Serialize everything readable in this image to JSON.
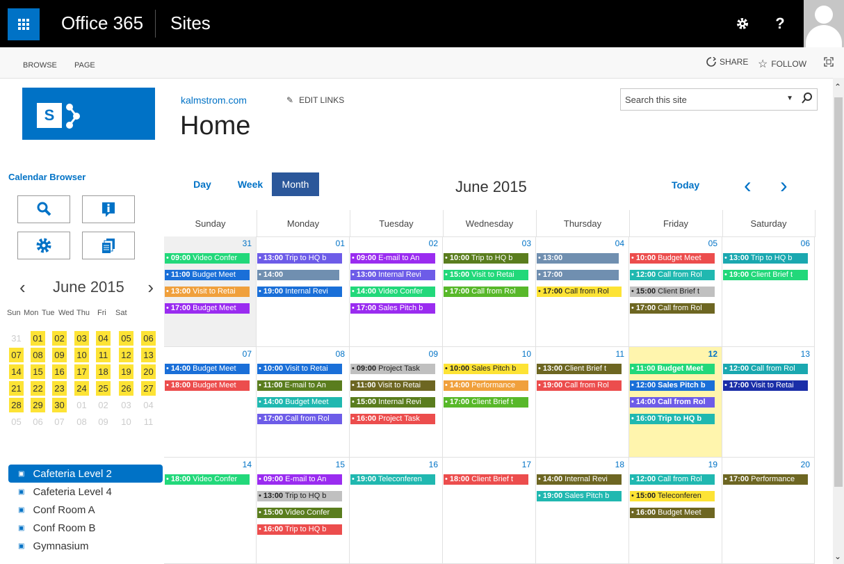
{
  "suite": {
    "app_name": "Office 365",
    "section": "Sites"
  },
  "ribbon": {
    "tabs": [
      "BROWSE",
      "PAGE"
    ],
    "share": "SHARE",
    "follow": "FOLLOW"
  },
  "header": {
    "site_link": "kalmstrom.com",
    "edit_links": "EDIT LINKS",
    "title": "Home"
  },
  "search": {
    "placeholder": "Search this site"
  },
  "calendar_browser": {
    "title": "Calendar Browser",
    "mini": {
      "title": "June 2015",
      "weekdays": [
        "Sun",
        "Mon",
        "Tue",
        "Wed",
        "Thu",
        "Fri",
        "Sat"
      ],
      "weeks": [
        [
          "31",
          "01",
          "02",
          "03",
          "04",
          "05",
          "06"
        ],
        [
          "07",
          "08",
          "09",
          "10",
          "11",
          "12",
          "13"
        ],
        [
          "14",
          "15",
          "16",
          "17",
          "18",
          "19",
          "20"
        ],
        [
          "21",
          "22",
          "23",
          "24",
          "25",
          "26",
          "27"
        ],
        [
          "28",
          "29",
          "30",
          "01",
          "02",
          "03",
          "04"
        ],
        [
          "05",
          "06",
          "07",
          "08",
          "09",
          "10",
          "11"
        ]
      ]
    }
  },
  "resources": [
    "Cafeteria Level 2",
    "Cafeteria Level 4",
    "Conf Room A",
    "Conf Room B",
    "Gymnasium"
  ],
  "calendar": {
    "views": [
      "Day",
      "Week",
      "Month"
    ],
    "active_view": "Month",
    "month_title": "June 2015",
    "today_label": "Today",
    "days": [
      "Sunday",
      "Monday",
      "Tuesday",
      "Wednesday",
      "Thursday",
      "Friday",
      "Saturday"
    ],
    "weeks": [
      {
        "dates": [
          "31",
          "01",
          "02",
          "03",
          "04",
          "05",
          "06"
        ],
        "events": [
          [
            [
              "09:00",
              "Video Confer",
              "#22d87a"
            ],
            [
              "11:00",
              "Budget Meet",
              "#1a6fd8"
            ],
            [
              "13:00",
              "Visit to Retai",
              "#f0a03c"
            ],
            [
              "17:00",
              "Budget Meet",
              "#9a2cf0"
            ]
          ],
          [
            [
              "13:00",
              "Trip to HQ b",
              "#6d5ce8"
            ],
            [
              "14:00",
              "",
              "#708fb0"
            ],
            [
              "19:00",
              "Internal Revi",
              "#1a6fd8"
            ]
          ],
          [
            [
              "09:00",
              "E-mail to An",
              "#9a2cf0"
            ],
            [
              "13:00",
              "Internal Revi",
              "#6d5ce8"
            ],
            [
              "14:00",
              "Video Confer",
              "#22d87a"
            ],
            [
              "17:00",
              "Sales Pitch b",
              "#9a2cf0"
            ]
          ],
          [
            [
              "10:00",
              "Trip to HQ b",
              "#5a7d1e"
            ],
            [
              "15:00",
              "Visit to Retai",
              "#22d87a"
            ],
            [
              "17:00",
              "Call from Rol",
              "#58b82a"
            ]
          ],
          [
            [
              "13:00",
              "",
              "#708fb0"
            ],
            [
              "17:00",
              "",
              "#708fb0"
            ],
            [
              "17:00",
              "Call from Rol",
              "#fde335"
            ]
          ],
          [
            [
              "10:00",
              "Budget Meet",
              "#ec4d4d"
            ],
            [
              "12:00",
              "Call from Rol",
              "#20b8b0"
            ],
            [
              "15:00",
              "Client Brief t",
              "#c0c0c0"
            ],
            [
              "17:00",
              "Call from Rol",
              "#6d6622"
            ]
          ],
          [
            [
              "13:00",
              "Trip to HQ b",
              "#1aa8b0"
            ],
            [
              "19:00",
              "Client Brief t",
              "#22d87a"
            ]
          ]
        ]
      },
      {
        "dates": [
          "07",
          "08",
          "09",
          "10",
          "11",
          "12",
          "13"
        ],
        "events": [
          [
            [
              "14:00",
              "Budget Meet",
              "#1a6fd8"
            ],
            [
              "18:00",
              "Budget Meet",
              "#ec4d4d"
            ]
          ],
          [
            [
              "10:00",
              "Visit to Retai",
              "#1a6fd8"
            ],
            [
              "11:00",
              "E-mail to An",
              "#5a7d1e"
            ],
            [
              "14:00",
              "Budget Meet",
              "#20b8b0"
            ],
            [
              "17:00",
              "Call from Rol",
              "#6d5ce8"
            ]
          ],
          [
            [
              "09:00",
              "Project Task",
              "#c0c0c0"
            ],
            [
              "11:00",
              "Visit to Retai",
              "#6d6622"
            ],
            [
              "15:00",
              "Internal Revi",
              "#5a7d1e"
            ],
            [
              "16:00",
              "Project Task",
              "#ec4d4d"
            ]
          ],
          [
            [
              "10:00",
              "Sales Pitch b",
              "#fde335"
            ],
            [
              "14:00",
              "Performance",
              "#f0a03c"
            ],
            [
              "17:00",
              "Client Brief t",
              "#58b82a"
            ]
          ],
          [
            [
              "13:00",
              "Client Brief t",
              "#6d6622"
            ],
            [
              "19:00",
              "Call from Rol",
              "#ec4d4d"
            ]
          ],
          [
            [
              "11:00",
              "Budget Meet",
              "#22d87a"
            ],
            [
              "12:00",
              "Sales Pitch b",
              "#1a6fd8"
            ],
            [
              "14:00",
              "Call from Rol",
              "#6d5ce8"
            ],
            [
              "16:00",
              "Trip to HQ b",
              "#20b8b0"
            ]
          ],
          [
            [
              "12:00",
              "Call from Rol",
              "#1aa8b0"
            ],
            [
              "17:00",
              "Visit to Retai",
              "#1a2ea8"
            ]
          ]
        ]
      },
      {
        "dates": [
          "14",
          "15",
          "16",
          "17",
          "18",
          "19",
          "20"
        ],
        "events": [
          [
            [
              "18:00",
              "Video Confer",
              "#22d87a"
            ]
          ],
          [
            [
              "09:00",
              "E-mail to An",
              "#9a2cf0"
            ],
            [
              "13:00",
              "Trip to HQ b",
              "#c0c0c0"
            ],
            [
              "15:00",
              "Video Confer",
              "#5a7d1e"
            ],
            [
              "16:00",
              "Trip to HQ b",
              "#ec4d4d"
            ]
          ],
          [
            [
              "19:00",
              "Teleconferen",
              "#20b8b0"
            ]
          ],
          [
            [
              "18:00",
              "Client Brief t",
              "#ec4d4d"
            ]
          ],
          [
            [
              "14:00",
              "Internal Revi",
              "#6d6622"
            ],
            [
              "19:00",
              "Sales Pitch b",
              "#20b8b0"
            ]
          ],
          [
            [
              "12:00",
              "Call from Rol",
              "#20b8b0"
            ],
            [
              "15:00",
              "Teleconferen",
              "#fde335"
            ],
            [
              "16:00",
              "Budget Meet",
              "#6d6622"
            ]
          ],
          [
            [
              "17:00",
              "Performance",
              "#6d6622"
            ]
          ]
        ]
      }
    ]
  }
}
